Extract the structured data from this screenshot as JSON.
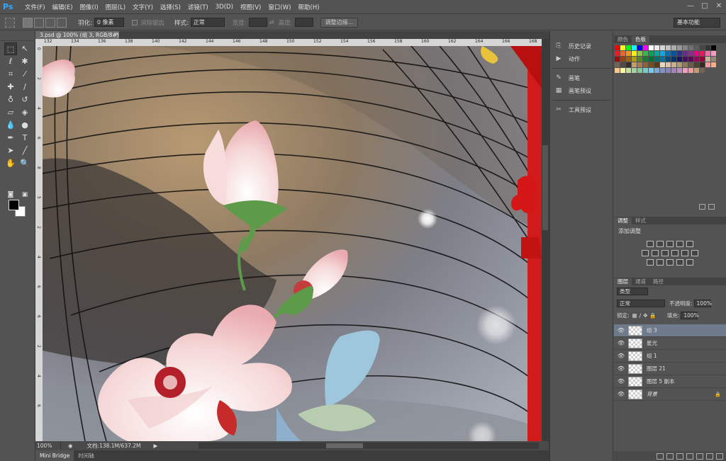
{
  "app": {
    "logo": "Ps"
  },
  "menu": [
    "文件(F)",
    "编辑(E)",
    "图像(I)",
    "图层(L)",
    "文字(Y)",
    "选择(S)",
    "滤镜(T)",
    "3D(D)",
    "视图(V)",
    "窗口(W)",
    "帮助(H)"
  ],
  "window_controls": {
    "min": "—",
    "max": "□",
    "close": "✕"
  },
  "options": {
    "feather_label": "羽化:",
    "feather_value": "0 像素",
    "antialias_label": "消除锯齿",
    "style_label": "样式:",
    "style_value": "正常",
    "width_label": "宽度:",
    "height_label": "高度:",
    "refine_edge": "调整边缘..."
  },
  "workspace": "基本功能",
  "document": {
    "tab": "3.psd @ 100% (组 3, RGB/8#)",
    "zoom": "100%",
    "doc_info": "文档:138.1M/637.2M"
  },
  "ruler_top": [
    "132",
    "134",
    "136",
    "138",
    "140",
    "142",
    "144",
    "146",
    "148",
    "150",
    "152",
    "154",
    "156",
    "158",
    "160",
    "162",
    "164",
    "166",
    "168"
  ],
  "ruler_left": [
    "0",
    "2",
    "4",
    "6",
    "8",
    "5",
    "2",
    "4",
    "6",
    "6",
    "2",
    "4",
    "6"
  ],
  "bottom_tabs": [
    "Mini Bridge",
    "时间轴"
  ],
  "collapsed_panels": [
    {
      "icon": "history-icon",
      "label": "历史记录"
    },
    {
      "icon": "actions-icon",
      "label": "动作"
    },
    {
      "icon": "brush-icon",
      "label": "画笔"
    },
    {
      "icon": "brush-presets-icon",
      "label": "画笔预设"
    },
    {
      "icon": "tool-presets-icon",
      "label": "工具预设"
    }
  ],
  "swatch_tabs": [
    "颜色",
    "色板"
  ],
  "swatch_colors": [
    "#ff0000",
    "#ffff00",
    "#00ff00",
    "#00ffff",
    "#0000ff",
    "#ff00ff",
    "#ffffff",
    "#ebebeb",
    "#d6d6d6",
    "#c2c2c2",
    "#adadad",
    "#999999",
    "#858585",
    "#707070",
    "#5c5c5c",
    "#474747",
    "#333333",
    "#000000",
    "#ed1c24",
    "#f26522",
    "#f7941d",
    "#fff200",
    "#8dc63f",
    "#39b54a",
    "#00a651",
    "#00a99d",
    "#00aeef",
    "#0072bc",
    "#0054a6",
    "#2e3192",
    "#662d91",
    "#92278f",
    "#ec008c",
    "#ed145b",
    "#f06eaa",
    "#f49ac1",
    "#9e0b0f",
    "#a0410d",
    "#a36209",
    "#aba000",
    "#598527",
    "#1a7b30",
    "#007236",
    "#00746b",
    "#0076a3",
    "#004b80",
    "#003471",
    "#1b1464",
    "#440e62",
    "#630460",
    "#9e005d",
    "#9e0039",
    "#c7b299",
    "#998675",
    "#736357",
    "#534741",
    "#37302a",
    "#c69c6d",
    "#a67c52",
    "#8c6239",
    "#754c24",
    "#603913",
    "#e6d7c3",
    "#d9c4a6",
    "#ccb089",
    "#b39c73",
    "#8c7b5c",
    "#6b5d45",
    "#4d4233",
    "#332b22",
    "#f5989d",
    "#f9ad81",
    "#fdc689",
    "#fff799",
    "#c4df9b",
    "#a3d39c",
    "#82ca9c",
    "#7accc8",
    "#6dcff6",
    "#7da7d9",
    "#8393ca",
    "#8781bd",
    "#a186be",
    "#bc8dbf",
    "#f49ac2",
    "#f6989d",
    "#c69c6d",
    "#736357"
  ],
  "adjust_tabs": [
    "调整",
    "样式"
  ],
  "adjust_title": "添加调整",
  "layers_tabs": [
    "图层",
    "通道",
    "路径"
  ],
  "layers": {
    "filter": "类型",
    "blend": "正常",
    "opacity_label": "不透明度:",
    "opacity": "100%",
    "lock_label": "锁定:",
    "fill_label": "填充:",
    "fill": "100%",
    "items": [
      {
        "name": "组 3",
        "active": true
      },
      {
        "name": "星光",
        "active": false
      },
      {
        "name": "组 1",
        "active": false
      },
      {
        "name": "图层 21",
        "active": false
      },
      {
        "name": "图层 5 副本",
        "active": false
      },
      {
        "name": "背景",
        "active": false
      }
    ]
  }
}
